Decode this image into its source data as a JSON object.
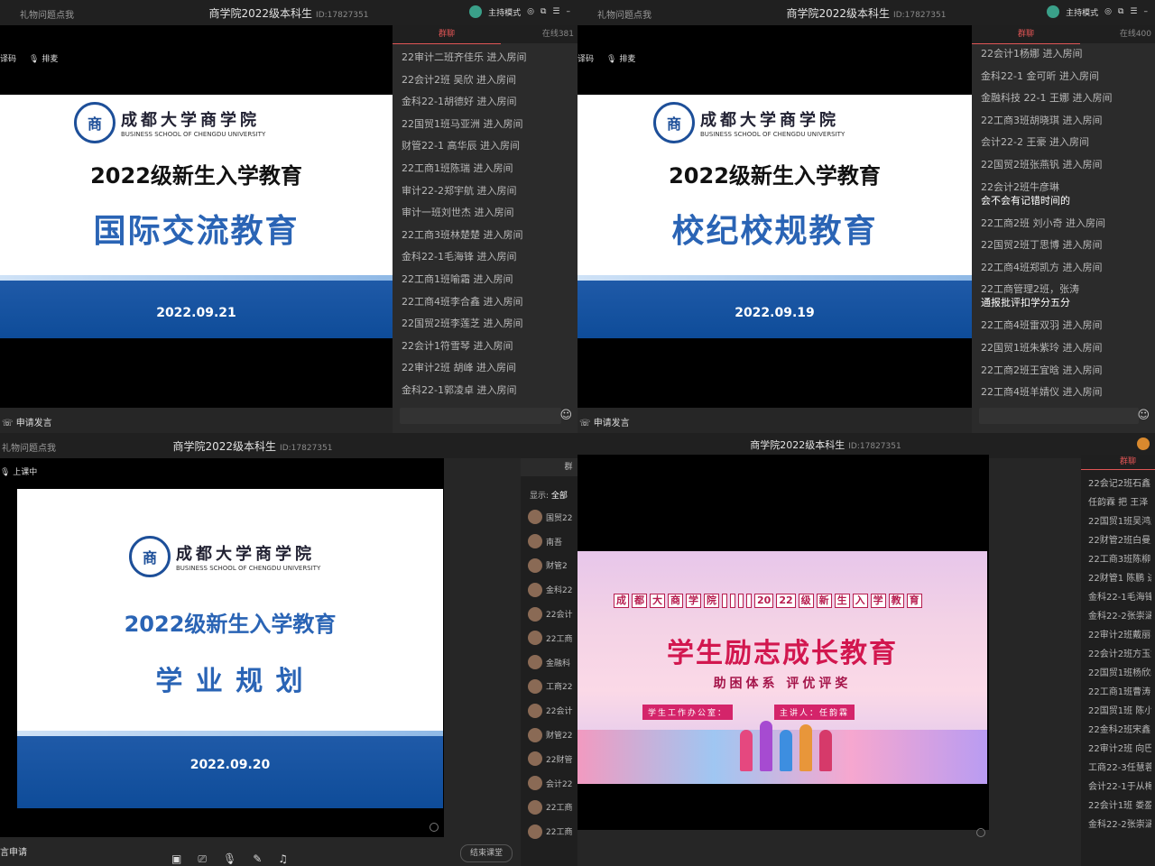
{
  "q1": {
    "left_label": "礼物问题点我",
    "title": "商学院2022级本科生",
    "id": "ID:17827351",
    "host_mode": "主持模式",
    "tools": [
      "译码",
      "排麦"
    ],
    "slide": {
      "school_cn": "成都大学商学院",
      "school_en": "BUSINESS SCHOOL OF CHENGDU UNIVERSITY",
      "seal": "商",
      "heading": "2022级新生入学教育",
      "topic": "国际交流教育",
      "date": "2022.09.21"
    },
    "chat_tab": "群聊",
    "online": "在线381",
    "messages": [
      "22审计二班齐佳乐 进入房间",
      "22会计2班 吴欣 进入房间",
      "金科22-1胡德好 进入房间",
      "22国贸1班马亚洲 进入房间",
      "财管22-1 高华辰 进入房间",
      "22工商1班陈瑞 进入房间",
      "审计22-2郑宇航 进入房间",
      "审计一班刘世杰 进入房间",
      "22工商3班林楚楚 进入房间",
      "金科22-1毛海锋 进入房间",
      "22工商1班喻霜 进入房间",
      "22工商4班李合鑫 进入房间",
      "22国贸2班李莲芝 进入房间",
      "22会计1符雪琴 进入房间",
      "22审计2班 胡峰 进入房间",
      "金科22-1郭凌卓 进入房间"
    ],
    "apply": "申请发言"
  },
  "q2": {
    "left_label": "礼物问题点我",
    "title": "商学院2022级本科生",
    "id": "ID:17827351",
    "host_mode": "主持模式",
    "tools": [
      "译码",
      "排麦"
    ],
    "slide": {
      "school_cn": "成都大学商学院",
      "school_en": "BUSINESS SCHOOL OF CHENGDU UNIVERSITY",
      "seal": "商",
      "heading": "2022级新生入学教育",
      "topic": "校纪校规教育",
      "date": "2022.09.19"
    },
    "chat_tab": "群聊",
    "online": "在线400",
    "messages": [
      {
        "t": "22会计1杨娜 进入房间"
      },
      {
        "t": "金科22-1 金可昕 进入房间"
      },
      {
        "t": "金融科技 22-1 王娜 进入房间"
      },
      {
        "t": "22工商3班胡晓琪 进入房间"
      },
      {
        "t": "会计22-2 王豪 进入房间"
      },
      {
        "t": "22国贸2班张燕钒 进入房间"
      },
      {
        "t": "22会计2班牛彦琳",
        "m": "会不会有记错时间的"
      },
      {
        "t": "22工商2班 刘小奇 进入房间"
      },
      {
        "t": "22国贸2班丁思博 进入房间"
      },
      {
        "t": "22工商4班郑凯方 进入房间"
      },
      {
        "t": "22工商管理2班，张涛",
        "m": "通报批评扣学分五分"
      },
      {
        "t": "22工商4班雷双羽 进入房间"
      },
      {
        "t": "22国贸1班朱紫玲 进入房间"
      },
      {
        "t": "22工商2班王宜晗 进入房间"
      },
      {
        "t": "22工商4班羊婧仪 进入房间"
      }
    ],
    "apply": "申请发言"
  },
  "q3": {
    "left_label": "礼物问题点我",
    "title": "商学院2022级本科生",
    "id": "ID:17827351",
    "status": "上课中",
    "slide": {
      "school_cn": "成都大学商学院",
      "school_en": "BUSINESS SCHOOL OF CHENGDU UNIVERSITY",
      "seal": "商",
      "heading": "2022级新生入学教育",
      "topic": "学 业 规 划",
      "date": "2022.09.20"
    },
    "chat_tab": "群",
    "display_label": "显示:",
    "display_value": "全部",
    "users": [
      "国贸22",
      "南吾",
      "财管2",
      "金科22",
      "22会计",
      "22工商",
      "金融科",
      "工商22",
      "22会计",
      "财管22",
      "22财管",
      "会计22",
      "22工商",
      "22工商"
    ],
    "apply": "言申请",
    "end_class": "结束课堂"
  },
  "q4": {
    "title": "商学院2022级本科生",
    "id": "ID:17827351",
    "chat_tab": "群聊",
    "poster": {
      "head": [
        "成",
        "都",
        "大",
        "商",
        "学",
        "院",
        "",
        "",
        "",
        "",
        "20",
        "22",
        "级",
        "新",
        "生",
        "入",
        "学",
        "教",
        "育"
      ],
      "title": "学生励志成长教育",
      "subtitle": "助困体系  评优评奖",
      "office": "学生工作办公室：",
      "speaker": "主讲人：任韵霖"
    },
    "messages": [
      "22会记2班石鑫 进",
      "任韵霖 把 王泽",
      "22国贸1班吴鸿超",
      "22财管2班白曼曼",
      "22工商3班陈柳 进",
      "22财管1 陈鹏 进入",
      "金科22-1毛海锋 进",
      "金科22-2张崇涵 进",
      "22审计2班戴丽容",
      "22会计2班方玉婷",
      "22国贸1班杨欣颖",
      "22工商1班曹涛 进",
      "22国贸1班 陈小园",
      "22金科2班宋鑫 进",
      "22审计2班 向巴维",
      "工商22-3任慧蓉 进",
      "会计22-1于从梅 进",
      "22会计1班 娄盈盈",
      "金科22-2张崇涵 进"
    ]
  }
}
